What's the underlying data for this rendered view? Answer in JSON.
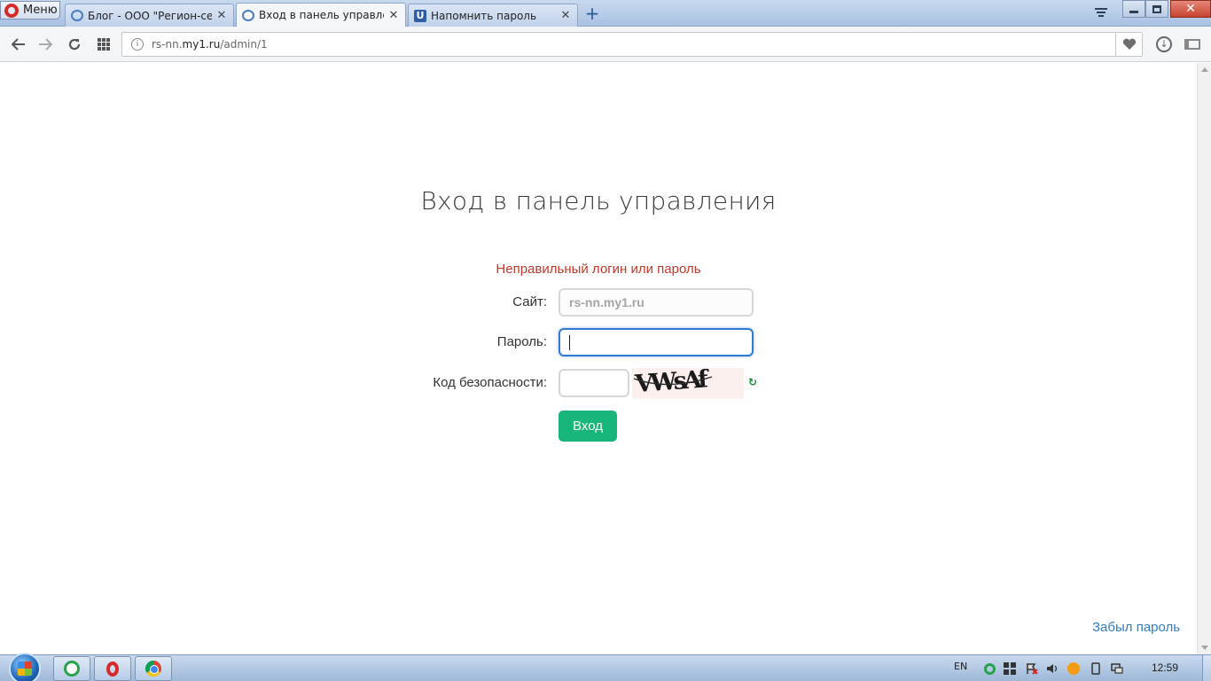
{
  "browser": {
    "menu_label": "Меню",
    "tabs": [
      {
        "label": "Блог - ООО \"Регион-серв",
        "favicon": "diamond-icon",
        "active": false
      },
      {
        "label": "Вход в панель управлени",
        "favicon": "diamond-icon",
        "active": true
      },
      {
        "label": "Напомнить пароль",
        "favicon": "u-icon",
        "active": false
      }
    ],
    "new_tab_label": "+",
    "address": {
      "prefix": "rs-nn.",
      "domain": "my1.ru",
      "path": "/admin/1"
    }
  },
  "page": {
    "title": "Вход в панель управления",
    "error": "Неправильный логин или пароль",
    "form": {
      "site_label": "Сайт:",
      "site_value": "rs-nn.my1.ru",
      "password_label": "Пароль:",
      "password_value": "",
      "code_label": "Код безопасности:",
      "code_value": "",
      "captcha_text": "VWsAf",
      "submit_label": "Вход"
    },
    "forgot_link": "Забыл пароль"
  },
  "taskbar": {
    "language": "EN",
    "clock": "12:59"
  },
  "colors": {
    "error": "#c0392b",
    "submit_button": "#18b67a",
    "link": "#2e7fc1",
    "focus_border": "#2f7ad6"
  }
}
